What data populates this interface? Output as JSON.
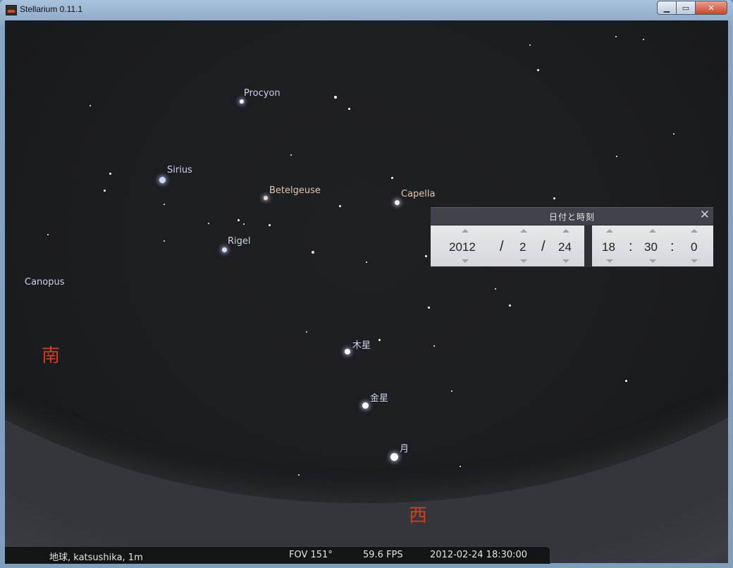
{
  "window": {
    "title": "Stellarium 0.11.1",
    "controls": {
      "minimize": "▁",
      "maximize": "▭",
      "close": "✕"
    }
  },
  "sky": {
    "labels": {
      "procyon": "Procyon",
      "sirius": "Sirius",
      "betelgeuse": "Betelgeuse",
      "capella": "Capella",
      "rigel": "Rigel",
      "canopus": "Canopus",
      "jupiter": "木星",
      "venus": "金星",
      "moon": "月"
    },
    "cardinals": {
      "south": "南",
      "west": "西"
    }
  },
  "date_time_dialog": {
    "title": "日付と時刻",
    "close": "✕",
    "year": "2012",
    "month": "2",
    "day": "24",
    "hour": "18",
    "minute": "30",
    "second": "0",
    "date_separator": "/",
    "time_separator": ":"
  },
  "status_bar": {
    "location": "地球, katsushika, 1m",
    "fov": "FOV 151°",
    "fps": "59.6 FPS",
    "datetime": "2012-02-24   18:30:00"
  }
}
